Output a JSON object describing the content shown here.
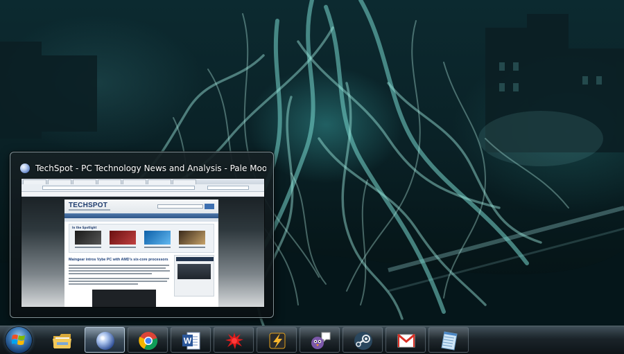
{
  "preview": {
    "title": "TechSpot - PC Technology News and Analysis - Pale Moon (...",
    "page": {
      "logo": "TECHSPOT",
      "section": "In the Spotlight",
      "headline": "Maingear intros Vybe PC with AMD's six-core processors"
    }
  },
  "taskbar": {
    "start_icon": "windows-logo-icon",
    "items": [
      {
        "icon": "folder-icon",
        "name": "windows-explorer"
      },
      {
        "icon": "globe-icon",
        "name": "pale-moon"
      },
      {
        "icon": "chrome-icon",
        "name": "google-chrome"
      },
      {
        "icon": "word-icon",
        "name": "microsoft-word"
      },
      {
        "icon": "splat-icon",
        "name": "red-splat-app"
      },
      {
        "icon": "lightning-icon",
        "name": "winamp"
      },
      {
        "icon": "chat-bird-icon",
        "name": "pidgin"
      },
      {
        "icon": "steam-icon",
        "name": "steam"
      },
      {
        "icon": "gmail-icon",
        "name": "gmail"
      },
      {
        "icon": "notepad-icon",
        "name": "notepad"
      }
    ]
  }
}
